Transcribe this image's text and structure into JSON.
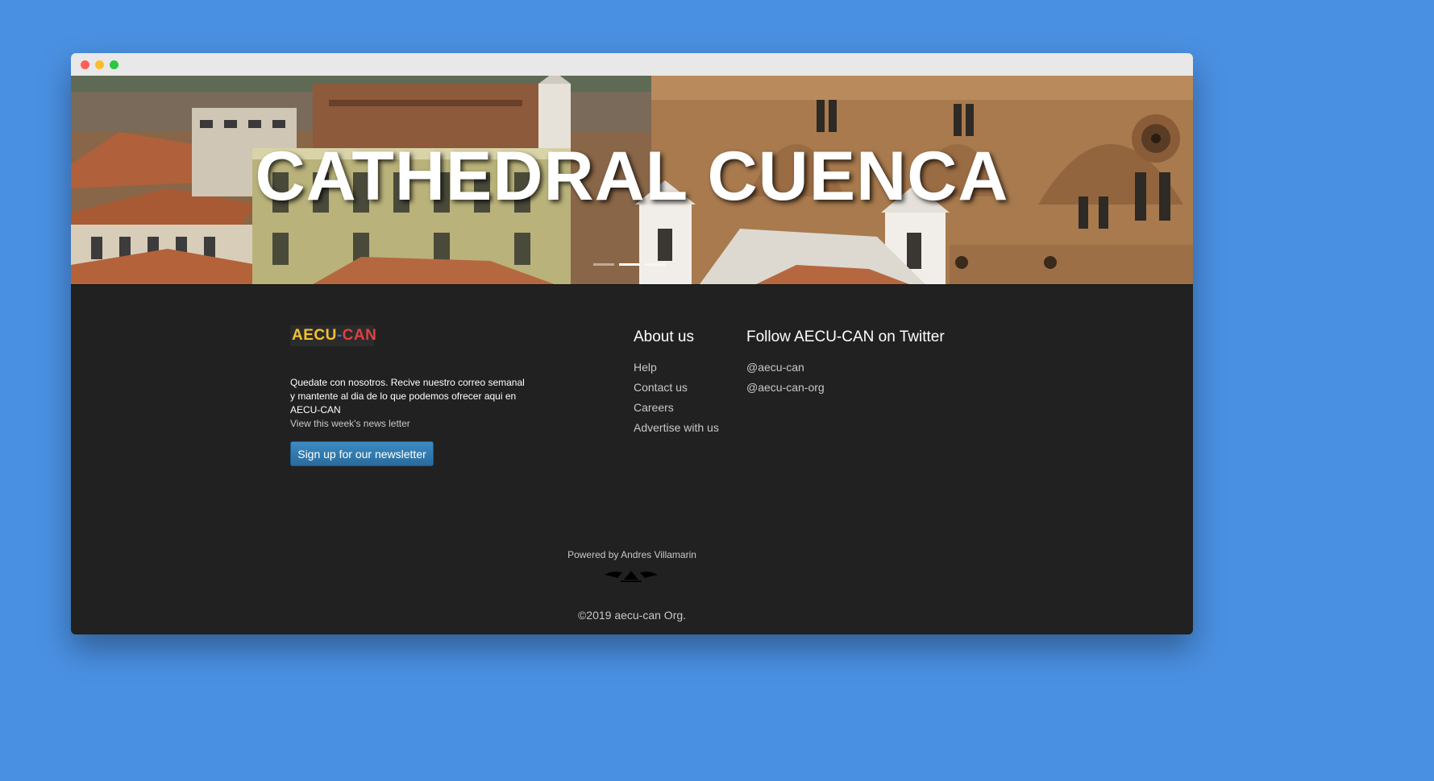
{
  "hero": {
    "title": "CATHEDRAL CUENCA"
  },
  "footer": {
    "logo": {
      "part1": "AECU",
      "part2": "-",
      "part3": "CAN"
    },
    "newsletter_text": "Quedate con nosotros. Recive nuestro correo semanal y mantente al dia de lo que podemos ofrecer aqui en AECU-CAN",
    "news_link": "View this week's news letter",
    "signup_button": "Sign up for our newsletter",
    "about": {
      "heading": "About us",
      "links": [
        "Help",
        "Contact us",
        "Careers",
        "Advertise with us"
      ]
    },
    "twitter": {
      "heading": "Follow AECU-CAN on Twitter",
      "links": [
        "@aecu-can",
        "@aecu-can-org"
      ]
    },
    "powered_by": "Powered by Andres Villamarin",
    "copyright": "©2019 aecu-can Org."
  },
  "colors": {
    "page_background": "#4a90e2",
    "footer_background": "#212121",
    "button": "#2f7bb3"
  }
}
